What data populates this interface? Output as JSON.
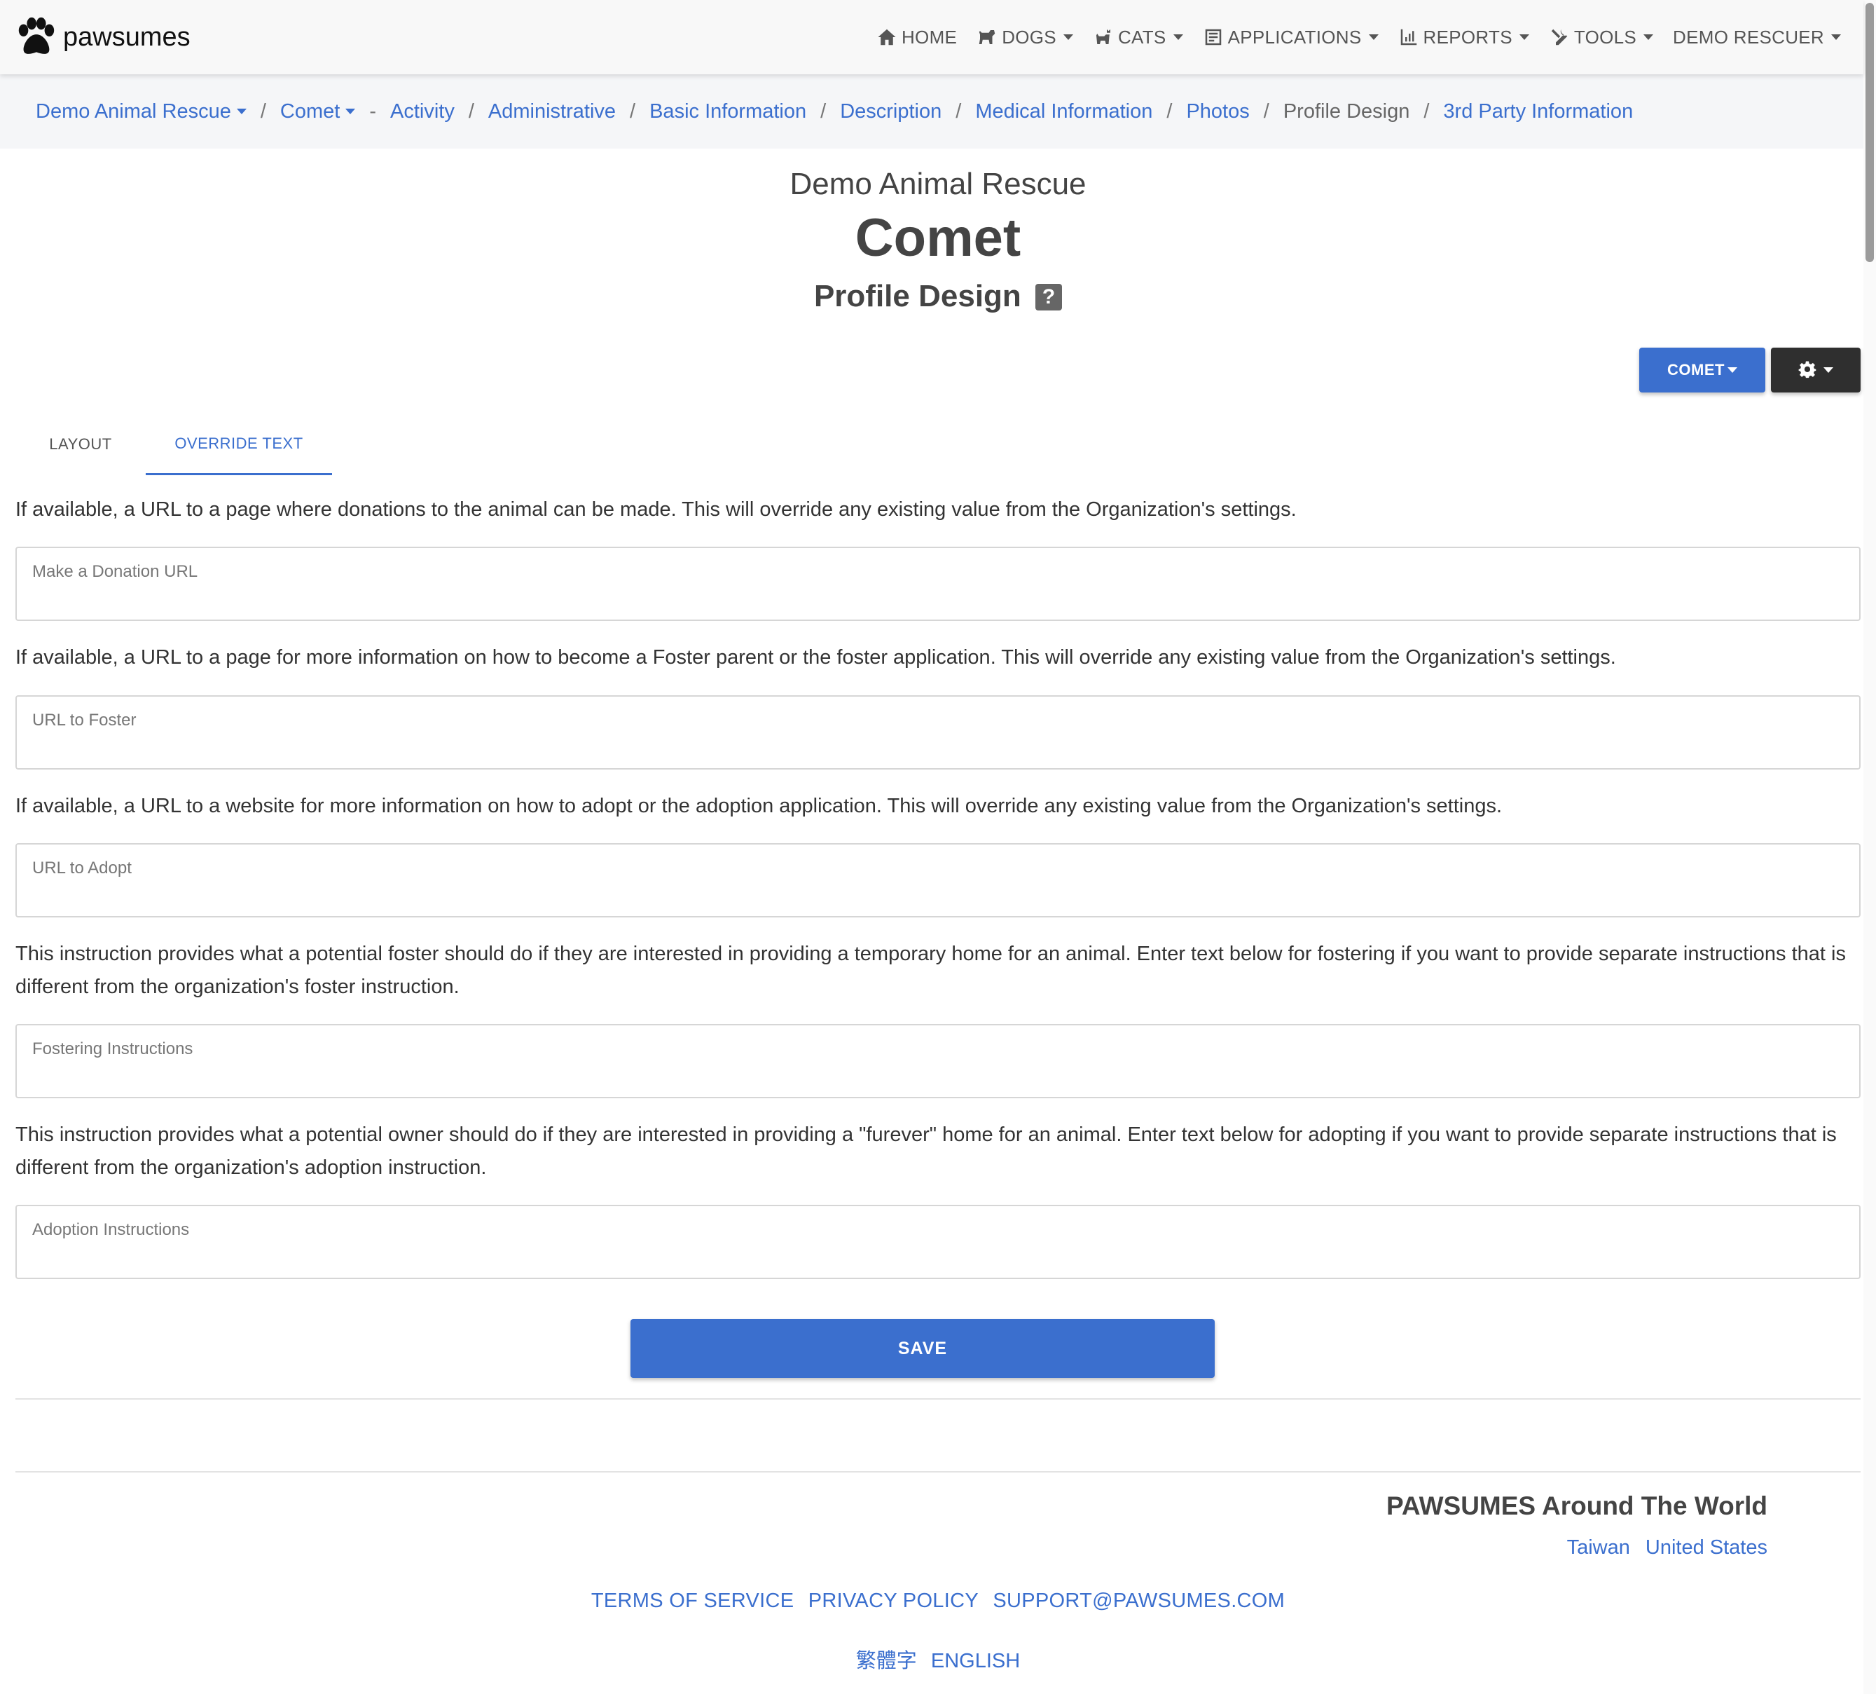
{
  "brand": {
    "name": "pawsumes"
  },
  "nav": {
    "items": [
      {
        "label": "HOME",
        "icon": "home-icon"
      },
      {
        "label": "DOGS",
        "icon": "dog-icon"
      },
      {
        "label": "CATS",
        "icon": "cat-icon"
      },
      {
        "label": "APPLICATIONS",
        "icon": "application-icon"
      },
      {
        "label": "REPORTS",
        "icon": "chart-icon"
      },
      {
        "label": "TOOLS",
        "icon": "tools-icon"
      },
      {
        "label": "DEMO RESCUER",
        "icon": ""
      }
    ]
  },
  "breadcrumb": {
    "org": "Demo Animal Rescue",
    "animal": "Comet",
    "dash": "-",
    "sep": "/",
    "links": [
      "Activity",
      "Administrative",
      "Basic Information",
      "Description",
      "Medical Information",
      "Photos"
    ],
    "current": "Profile Design",
    "last": "3rd Party Information"
  },
  "header": {
    "org": "Demo Animal Rescue",
    "animal": "Comet",
    "page": "Profile Design",
    "help": "?"
  },
  "actions": {
    "comet_label": "COMET",
    "gear_icon": "gear-icon"
  },
  "tabs": [
    {
      "label": "LAYOUT",
      "active": false
    },
    {
      "label": "OVERRIDE TEXT",
      "active": true
    }
  ],
  "form": {
    "fields": [
      {
        "desc": "If available, a URL to a page where donations to the animal can be made. This will override any existing value from the Organization's settings.",
        "label": "Make a Donation URL",
        "value": ""
      },
      {
        "desc": "If available, a URL to a page for more information on how to become a Foster parent or the foster application. This will override any existing value from the Organization's settings.",
        "label": "URL to Foster",
        "value": ""
      },
      {
        "desc": "If available, a URL to a website for more information on how to adopt or the adoption application. This will override any existing value from the Organization's settings.",
        "label": "URL to Adopt",
        "value": ""
      },
      {
        "desc": "This instruction provides what a potential foster should do if they are interested in providing a temporary home for an animal. Enter text below for fostering if you want to provide separate instructions that is different from the organization's foster instruction.",
        "label": "Fostering Instructions",
        "value": ""
      },
      {
        "desc": "This instruction provides what a potential owner should do if they are interested in providing a \"furever\" home for an animal. Enter text below for adopting if you want to provide separate instructions that is different from the organization's adoption instruction.",
        "label": "Adoption Instructions",
        "value": ""
      }
    ],
    "save_label": "SAVE"
  },
  "footer": {
    "world_title": "PAWSUMES Around The World",
    "countries": [
      "Taiwan",
      "United States"
    ],
    "links": [
      "TERMS OF SERVICE",
      "PRIVACY POLICY",
      "SUPPORT@PAWSUMES.COM"
    ],
    "languages": [
      "繁體字",
      "ENGLISH"
    ]
  },
  "colors": {
    "accent": "#3b6fce",
    "dark_button": "#2f2f2f",
    "navbar_bg": "#f8f8f8",
    "breadcrumb_bg": "#f5f6f8"
  }
}
